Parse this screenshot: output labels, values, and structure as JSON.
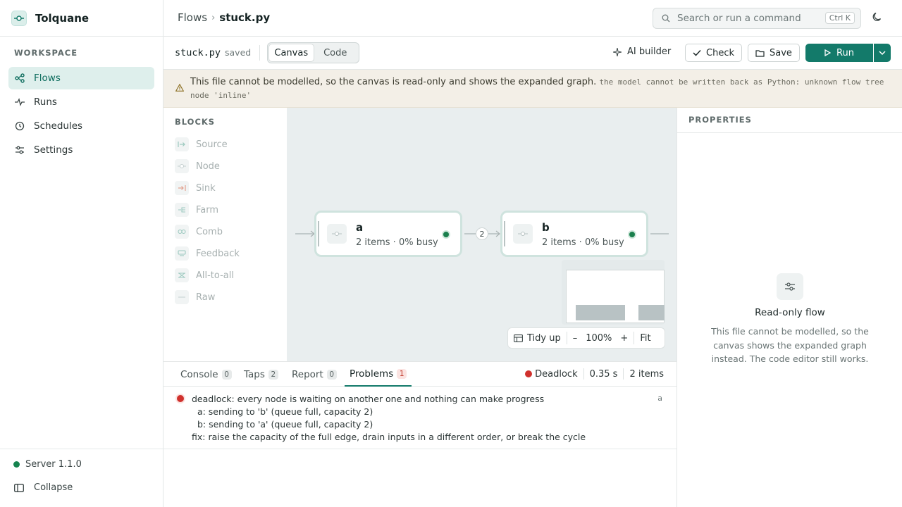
{
  "app": {
    "name": "Tolquane"
  },
  "sidebar": {
    "section_label": "WORKSPACE",
    "items": [
      {
        "label": "Flows",
        "icon": "flows-icon",
        "active": true
      },
      {
        "label": "Runs",
        "icon": "runs-icon"
      },
      {
        "label": "Schedules",
        "icon": "clock-icon"
      },
      {
        "label": "Settings",
        "icon": "sliders-icon"
      }
    ],
    "server_status": "Server 1.1.0",
    "collapse_label": "Collapse"
  },
  "header": {
    "breadcrumb": [
      "Flows",
      "stuck.py"
    ],
    "search_placeholder": "Search or run a command",
    "search_shortcut": "Ctrl K"
  },
  "toolbar": {
    "filename": "stuck.py",
    "save_state": "saved",
    "views": [
      "Canvas",
      "Code"
    ],
    "active_view": "Canvas",
    "ai_builder_label": "AI builder",
    "check_label": "Check",
    "save_label": "Save",
    "run_label": "Run"
  },
  "banner": {
    "message": "This file cannot be modelled, so the canvas is read-only and shows the expanded graph.",
    "detail": "the model cannot be written back as Python: unknown flow tree node 'inline'"
  },
  "blocks": {
    "title": "BLOCKS",
    "items": [
      "Source",
      "Node",
      "Sink",
      "Farm",
      "Comb",
      "Feedback",
      "All-to-all",
      "Raw"
    ]
  },
  "canvas": {
    "nodes": [
      {
        "name": "a",
        "meta": "2 items · 0% busy"
      },
      {
        "name": "b",
        "meta": "2 items · 0% busy"
      }
    ],
    "edge_label": "2",
    "controls": {
      "tidy_label": "Tidy up",
      "zoom_level": "100%",
      "fit_label": "Fit"
    }
  },
  "properties": {
    "title": "PROPERTIES",
    "empty_title": "Read-only flow",
    "empty_desc": "This file cannot be modelled, so the canvas shows the expanded graph instead. The code editor still works."
  },
  "bottom_panel": {
    "tabs": [
      {
        "label": "Console",
        "count": "0"
      },
      {
        "label": "Taps",
        "count": "2"
      },
      {
        "label": "Report",
        "count": "0"
      },
      {
        "label": "Problems",
        "count": "1"
      }
    ],
    "status": {
      "state": "Deadlock",
      "time": "0.35 s",
      "items": "2 items"
    },
    "problem": {
      "lines": [
        "deadlock: every node is waiting on another one and nothing can make progress",
        "  a: sending to 'b' (queue full, capacity 2)",
        "  b: sending to 'a' (queue full, capacity 2)",
        "fix: raise the capacity of the full edge, drain inputs in a different order, or break the cycle"
      ],
      "node": "a"
    }
  },
  "colors": {
    "accent": "#137a6a",
    "error": "#d0312d",
    "ok": "#16844f",
    "banner_bg": "#f3efe7"
  }
}
